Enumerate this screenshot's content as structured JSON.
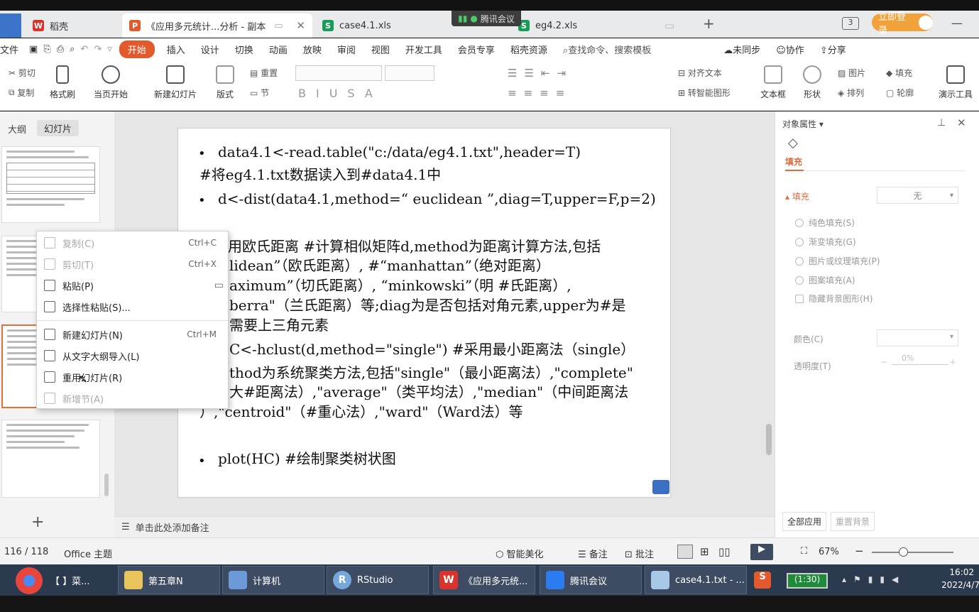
{
  "tabs": {
    "docer": "稻壳",
    "ppt": "《应用多元统计...分析 - 副本",
    "case": "case4.1.xls",
    "eg42": "eg4.2.xls",
    "new_tab": "+"
  },
  "meeting_badge": "腾讯会议",
  "login_label": "立即登录",
  "menu": {
    "file": "文件",
    "start": "开始",
    "insert": "插入",
    "design": "设计",
    "switch": "切换",
    "animation": "动画",
    "slideshow": "放映",
    "review": "审阅",
    "view": "视图",
    "devtools": "开发工具",
    "member": "会员专享",
    "docer_res": "稻壳资源",
    "search": "查找命令、搜索模板",
    "unsync": "未同步",
    "collab": "协作",
    "share": "分享"
  },
  "ribbon": {
    "cut": "剪切",
    "copy": "复制",
    "format_painter": "格式刷",
    "from_current": "当页开始",
    "new_slide": "新建幻灯片",
    "layout": "版式",
    "reset": "重置",
    "section": "节",
    "align_text": "对齐文本",
    "smartart": "转智能图形",
    "textbox": "文本框",
    "shape": "形状",
    "arrange": "排列",
    "picture": "图片",
    "fill": "填充",
    "outline": "轮廓",
    "present_tools": "演示工具"
  },
  "left_pane": {
    "outline_tab": "大纲",
    "slides_tab": "幻灯片",
    "add": "+"
  },
  "slide": {
    "l1": "data4.1<-read.table(\"c:/data/eg4.1.txt\",header=T)",
    "l2": "#将eg4.1.txt数据读入到#data4.1中",
    "l3": "d<-dist(data4.1,method=“ euclidean ”,diag=T,upper=F,p=2)",
    "l4": "用欧氏距离  #计算相似矩阵d,method为距离计算方法,包括",
    "l5": "lidean”（欧氏距离）, #“manhattan”（绝对距离）",
    "l6": "aximum”（切氏距离）, “minkowski”（明   #氏距离）,",
    "l7": "berra\"（兰氏距离）等;diag为是否包括对角元素,upper为#是",
    "l8": "需要上三角元素",
    "l9": "C<-hclust(d,method=\"single\") #采用最小距离法（single）",
    "l10": "thod为系统聚类方法,包括\"single\"（最小距离法）,\"complete\"",
    "l11": "大#距离法）,\"average\"（类平均法）,\"median\"（中间距离法",
    "l12": "）,\"centroid\"（#重心法）,\"ward\"（Ward法）等",
    "l13": "plot(HC) #绘制聚类树状图",
    "bullet": "•"
  },
  "context_menu": {
    "copy": "复制(C)",
    "copy_sc": "Ctrl+C",
    "cut": "剪切(T)",
    "cut_sc": "Ctrl+X",
    "paste": "粘贴(P)",
    "paste_special": "选择性粘贴(S)...",
    "new_slide": "新建幻灯片(N)",
    "new_slide_sc": "Ctrl+M",
    "import_outline": "从文字大纲导入(L)",
    "reuse": "重用幻灯片(R)",
    "new_section": "新增节(A)"
  },
  "notes_placeholder": "单击此处添加备注",
  "right_pane": {
    "title": "对象属性",
    "tab_fill": "填充",
    "fill_section": "填充",
    "fill_value": "无",
    "solid": "纯色填充(S)",
    "gradient": "渐变填充(G)",
    "picture_texture": "图片或纹理填充(P)",
    "pattern": "图案填充(A)",
    "hide_bg": "隐藏背景图形(H)",
    "color": "颜色(C)",
    "transparency": "透明度(T)",
    "transparency_value": "0%",
    "apply_all": "全部应用",
    "reset_bg": "重置背景"
  },
  "status": {
    "slide_count": "116 / 118",
    "theme": "Office 主题",
    "beautify": "智能美化",
    "notes": "备注",
    "comments": "批注",
    "zoom": "67%"
  },
  "taskbar": {
    "chrome": "【    】菜...",
    "folder": "第五章N",
    "computer": "计算机",
    "rstudio": "RStudio",
    "wps": "《应用多元统...",
    "tencent": "腾讯会议",
    "notepad": "case4.1.txt - ...",
    "battery": "(1:30)",
    "time": "16:02",
    "date": "2022/4/7"
  },
  "colors": {
    "accent": "#e25a2c",
    "taskbar": "#2b3a4f",
    "fill_accent": "#e06a3c"
  }
}
